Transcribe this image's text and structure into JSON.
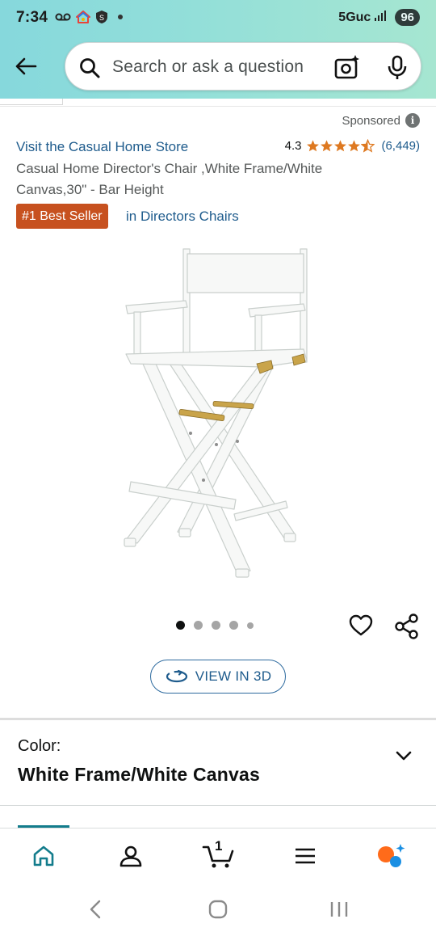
{
  "status_bar": {
    "time": "7:34",
    "network": "5Guc",
    "battery": "96"
  },
  "search": {
    "placeholder": "Search or ask a question"
  },
  "icons": {
    "back": "arrow-left-icon",
    "search": "search-icon",
    "camera": "camera-lens-icon",
    "mic": "microphone-icon",
    "heart": "heart-icon",
    "share": "share-icon",
    "rotate": "rotate-3d-icon",
    "chevron": "chevron-down-icon"
  },
  "product": {
    "sponsored": "Sponsored",
    "info_glyph": "i",
    "store_link": "Visit the Casual Home Store",
    "rating": "4.3",
    "rating_value": 4.3,
    "rating_count": "(6,449)",
    "title": "Casual Home Director's Chair ,White Frame/White Canvas,30\" - Bar Height",
    "badge": "#1 Best Seller",
    "badge_category": "in Directors Chairs",
    "image_alt": "white-directors-chair"
  },
  "carousel": {
    "total": 5,
    "active_index": 0
  },
  "view_3d": {
    "label": "VIEW IN 3D"
  },
  "variation": {
    "label": "Color:",
    "value": "White Frame/White Canvas"
  },
  "bottom_nav": {
    "items": [
      "home",
      "account",
      "cart",
      "menu",
      "rufus"
    ],
    "cart_count": "1"
  },
  "colors": {
    "header_start": "#86d8dc",
    "header_end": "#a6e6d1",
    "link": "#1f5c8d",
    "badge": "#c7511f",
    "star": "#de7921",
    "active_home": "#137c8c"
  }
}
